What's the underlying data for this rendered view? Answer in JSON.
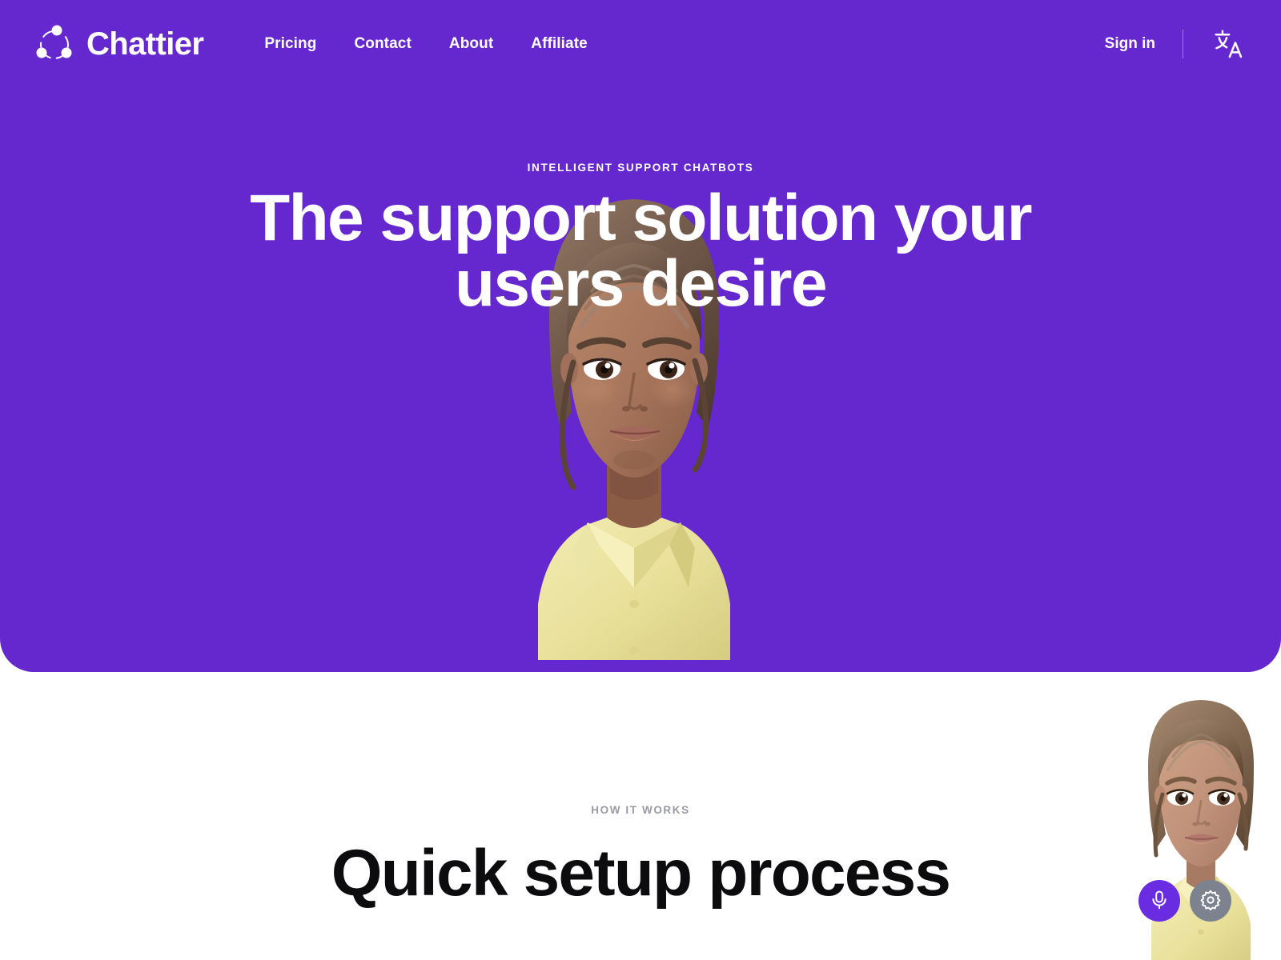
{
  "brand": {
    "name": "Chattier",
    "logo_icon": "network-nodes-icon",
    "accent_color": "#6527CE"
  },
  "nav": {
    "links": [
      {
        "label": "Pricing"
      },
      {
        "label": "Contact"
      },
      {
        "label": "About"
      },
      {
        "label": "Affiliate"
      }
    ],
    "sign_in_label": "Sign in",
    "language_icon": "translate-icon",
    "language_glyph": "文A"
  },
  "hero": {
    "eyebrow": "INTELLIGENT SUPPORT CHATBOTS",
    "title": "The support solution your users desire",
    "avatar_alt": "3d-avatar-woman-yellow-shirt",
    "background_color": "#6527CE"
  },
  "how_it_works": {
    "eyebrow": "HOW IT WORKS",
    "title": "Quick setup process",
    "eyebrow_color": "#9a9aa3",
    "title_color": "#0c0c0f"
  },
  "widget": {
    "avatar_alt": "3d-assistant-avatar",
    "mic_icon": "microphone-icon",
    "settings_icon": "gear-icon",
    "mic_color": "#6A2CE0",
    "settings_color": "#7C838F"
  }
}
